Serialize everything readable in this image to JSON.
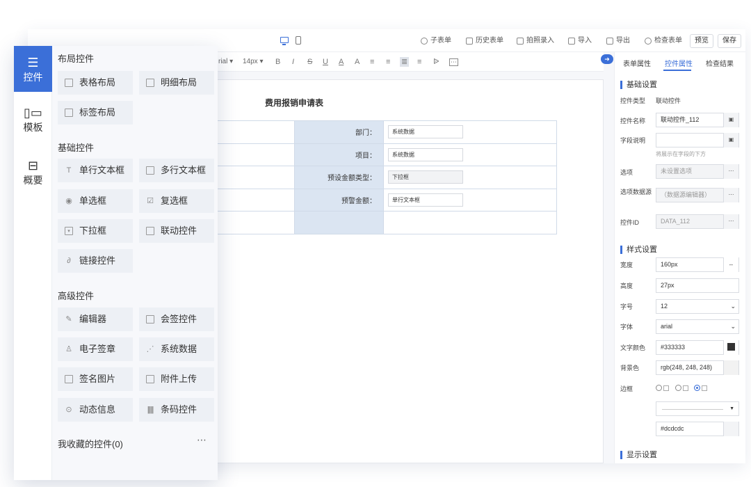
{
  "toolbar": {
    "items": [
      "子表单",
      "历史表单",
      "拍照录入",
      "导入",
      "导出",
      "检查表单"
    ],
    "preview": "预览",
    "save": "保存"
  },
  "format_bar": {
    "font": "rial",
    "size": "14px",
    "glyphs": [
      "B",
      "I",
      "S",
      "U",
      "A",
      "A"
    ]
  },
  "form": {
    "title": "费用报销申请表",
    "rows": [
      {
        "label": "部门：",
        "value": "系统数据",
        "gray": false
      },
      {
        "label": "项目：",
        "value": "系统数据",
        "gray": false
      },
      {
        "label": "预设金额类型：",
        "value": "下拉框",
        "gray": true
      },
      {
        "label": "预警金额：",
        "value": "单行文本框",
        "gray": false
      },
      {
        "label": "",
        "value": "",
        "gray": false
      }
    ]
  },
  "props": {
    "tabs": [
      "表单属性",
      "控件属性",
      "检查结果"
    ],
    "basic_title": "基础设置",
    "type_label": "控件类型",
    "type_value": "联动控件",
    "name_label": "控件名称",
    "name_value": "联动控件_112",
    "desc_label": "字段说明",
    "desc_hint": "将展示在字段的下方",
    "opt_label": "选项",
    "opt_value": "未设置选项",
    "src_label": "选项数据源",
    "src_value": "（数据源编辑器）",
    "id_label": "控件ID",
    "id_value": "DATA_112",
    "style_title": "样式设置",
    "width_label": "宽度",
    "width_value": "160px",
    "height_label": "高度",
    "height_value": "27px",
    "fsize_label": "字号",
    "fsize_value": "12",
    "ffam_label": "字体",
    "ffam_value": "arial",
    "color_label": "文字颜色",
    "color_value": "#333333",
    "bg_label": "背景色",
    "bg_value": "rgb(248, 248, 248)",
    "border_label": "边框",
    "border_color": "#dcdcdc",
    "display_title": "显示设置"
  },
  "rail": [
    {
      "label": "控件",
      "icon": "list-icon"
    },
    {
      "label": "模板",
      "icon": "template-icon"
    },
    {
      "label": "概要",
      "icon": "outline-icon"
    }
  ],
  "palette": {
    "layout_title": "布局控件",
    "layout": [
      "表格布局",
      "明细布局",
      "标签布局"
    ],
    "basic_title": "基础控件",
    "basic": [
      "单行文本框",
      "多行文本框",
      "单选框",
      "复选框",
      "下拉框",
      "联动控件",
      "链接控件"
    ],
    "advanced_title": "高级控件",
    "advanced": [
      "编辑器",
      "会签控件",
      "电子签章",
      "系统数据",
      "签名图片",
      "附件上传",
      "动态信息",
      "条码控件"
    ],
    "fav_title": "我收藏的控件(0)"
  },
  "colors": {
    "accent": "#3b6fd8",
    "label_cell": "#dbe5f2",
    "panel": "#f7f8fb",
    "chip": "#edf0f5"
  }
}
